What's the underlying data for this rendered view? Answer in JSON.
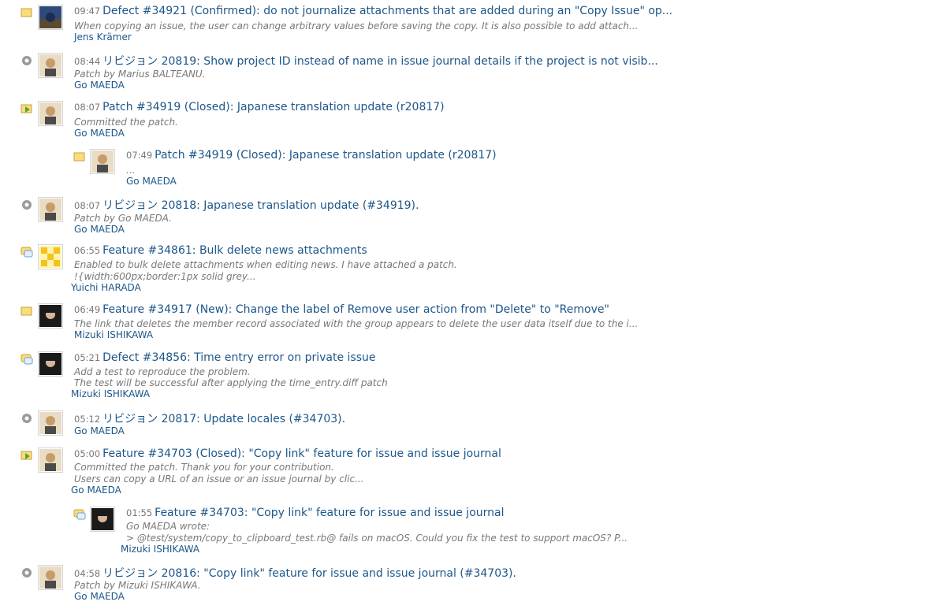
{
  "entries": [
    {
      "time": "09:47",
      "title": "Defect #34921 (Confirmed): do not journalize attachments that are added during an \"Copy Issue\" op...",
      "desc": [
        "When copying an issue, the user can change arbitrary values before saving the copy. It is also possible to add attach..."
      ],
      "author": "Jens Krämer",
      "icon": "note-icon",
      "avatar": "landscape"
    },
    {
      "time": "08:44",
      "title": "リビジョン 20819: Show project ID instead of name in issue journal details if the project is not visib...",
      "desc": [
        "Patch by Marius BALTEANU."
      ],
      "author": "Go MAEDA",
      "icon": "gear-icon",
      "avatar": "person"
    },
    {
      "time": "08:07",
      "title": "Patch #34919 (Closed): Japanese translation update (r20817)",
      "desc": [
        "Committed the patch."
      ],
      "author": "Go MAEDA",
      "icon": "closed-arrow-icon",
      "avatar": "person"
    },
    {
      "time": "07:49",
      "title": "Patch #34919 (Closed): Japanese translation update (r20817)",
      "desc": [
        "..."
      ],
      "author": "Go MAEDA",
      "icon": "note-icon",
      "avatar": "person"
    },
    {
      "time": "08:07",
      "title": "リビジョン 20818: Japanese translation update (#34919).",
      "desc": [
        "Patch by Go MAEDA."
      ],
      "author": "Go MAEDA",
      "icon": "gear-icon",
      "avatar": "person"
    },
    {
      "time": "06:55",
      "title": "Feature #34861: Bulk delete news attachments",
      "desc": [
        "Enabled to bulk delete attachments when editing news. I have attached a patch.",
        "!{width:600px;border:1px solid grey..."
      ],
      "author": "Yuichi HARADA",
      "icon": "comment-icon",
      "avatar": "pattern"
    },
    {
      "time": "06:49",
      "title": "Feature #34917 (New): Change the label of Remove user action from \"Delete\" to \"Remove\"",
      "desc": [
        "The link that deletes the member record associated with the group appears to delete the user data itself due to the i..."
      ],
      "author": "Mizuki ISHIKAWA",
      "icon": "note-icon",
      "avatar": "dark"
    },
    {
      "time": "05:21",
      "title": "Defect #34856: Time entry error on private issue",
      "desc": [
        "Add a test to reproduce the problem.",
        "The test will be successful after applying the time_entry.diff patch"
      ],
      "author": "Mizuki ISHIKAWA",
      "icon": "comment-icon",
      "avatar": "dark"
    },
    {
      "time": "05:12",
      "title": "リビジョン 20817: Update locales (#34703).",
      "desc": [],
      "author": "Go MAEDA",
      "icon": "gear-icon",
      "avatar": "person"
    },
    {
      "time": "05:00",
      "title": "Feature #34703 (Closed): \"Copy link\" feature for issue and issue journal",
      "desc": [
        "Committed the patch. Thank you for your contribution.",
        "Users can copy a URL of an issue or an issue journal by clic..."
      ],
      "author": "Go MAEDA",
      "icon": "closed-arrow-icon",
      "avatar": "person"
    },
    {
      "time": "01:55",
      "title": "Feature #34703: \"Copy link\" feature for issue and issue journal",
      "desc": [
        "Go MAEDA wrote:",
        "> @test/system/copy_to_clipboard_test.rb@ fails on macOS. Could you fix the test to support macOS? P..."
      ],
      "author": "Mizuki ISHIKAWA",
      "icon": "comment-icon",
      "avatar": "dark"
    },
    {
      "time": "04:58",
      "title": "リビジョン 20816: \"Copy link\" feature for issue and issue journal (#34703).",
      "desc": [
        "Patch by Mizuki ISHIKAWA."
      ],
      "author": "Go MAEDA",
      "icon": "gear-icon",
      "avatar": "person"
    }
  ]
}
